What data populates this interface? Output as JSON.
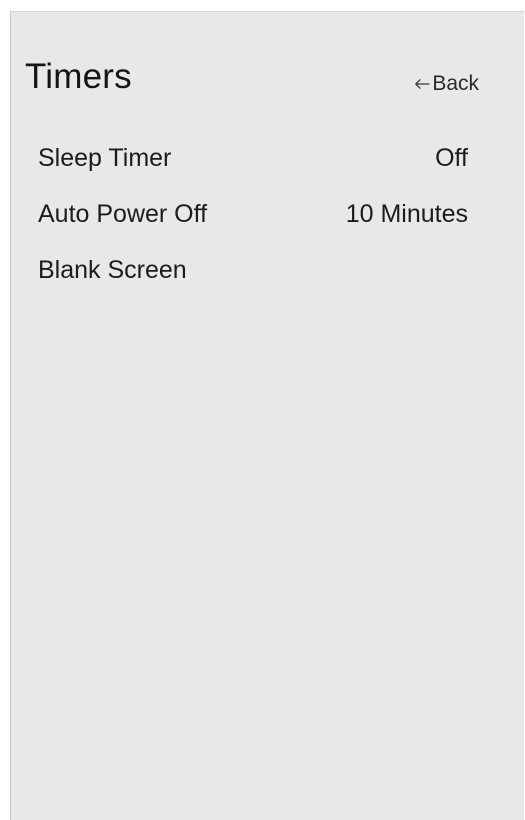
{
  "screen": {
    "title": "Timers",
    "back_label": "Back"
  },
  "menu": {
    "items": [
      {
        "label": "Sleep Timer",
        "value": "Off"
      },
      {
        "label": "Auto Power Off",
        "value": "10 Minutes"
      },
      {
        "label": "Blank Screen",
        "value": ""
      }
    ]
  },
  "icons": {
    "back": "arrow-left-icon"
  }
}
